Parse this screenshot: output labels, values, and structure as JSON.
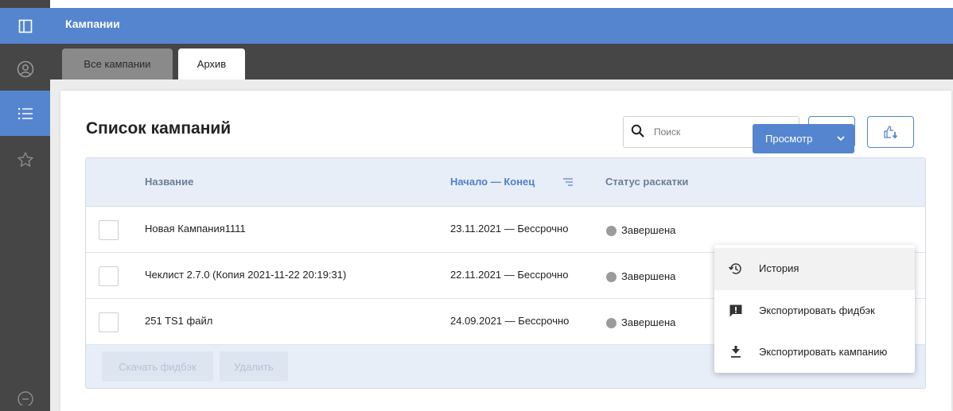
{
  "header": {
    "title": "Кампании"
  },
  "tabs": [
    {
      "label": "Все кампании",
      "active": false
    },
    {
      "label": "Архив",
      "active": true
    }
  ],
  "rail": {
    "items": [
      {
        "icon": "panel-toggle-icon"
      },
      {
        "icon": "user-circle-icon"
      },
      {
        "icon": "list-icon",
        "active": true
      },
      {
        "icon": "star-icon"
      },
      {
        "icon": "logout-icon"
      }
    ]
  },
  "main": {
    "title": "Список кампаний",
    "search": {
      "placeholder": "Поиск",
      "value": ""
    },
    "table": {
      "columns": [
        "Название",
        "Начало — Конец",
        "Статус раскатки"
      ],
      "rows": [
        {
          "name": "Новая Кампания1111",
          "period": "23.11.2021 — Бессрочно",
          "status": "Завершена"
        },
        {
          "name": "Чеклист 2.7.0 (Копия 2021-11-22 20:19:31)",
          "period": "22.11.2021 — Бессрочно",
          "status": "Завершена"
        },
        {
          "name": "251 TS1 файл",
          "period": "24.09.2021 — Бессрочно",
          "status": "Завершена"
        }
      ]
    },
    "footer": {
      "download_feedback": "Скачать фидбэк",
      "delete": "Удалить"
    },
    "row_action": {
      "label": "Просмотр"
    },
    "menu": {
      "items": [
        {
          "label": "История",
          "icon": "history-icon"
        },
        {
          "label": "Экспортировать фидбэк",
          "icon": "feedback-icon"
        },
        {
          "label": "Экспортировать кампанию",
          "icon": "download-icon"
        }
      ]
    }
  },
  "colors": {
    "accent": "#5585cf",
    "rail": "#464646",
    "status_done": "#9b9b9b"
  }
}
